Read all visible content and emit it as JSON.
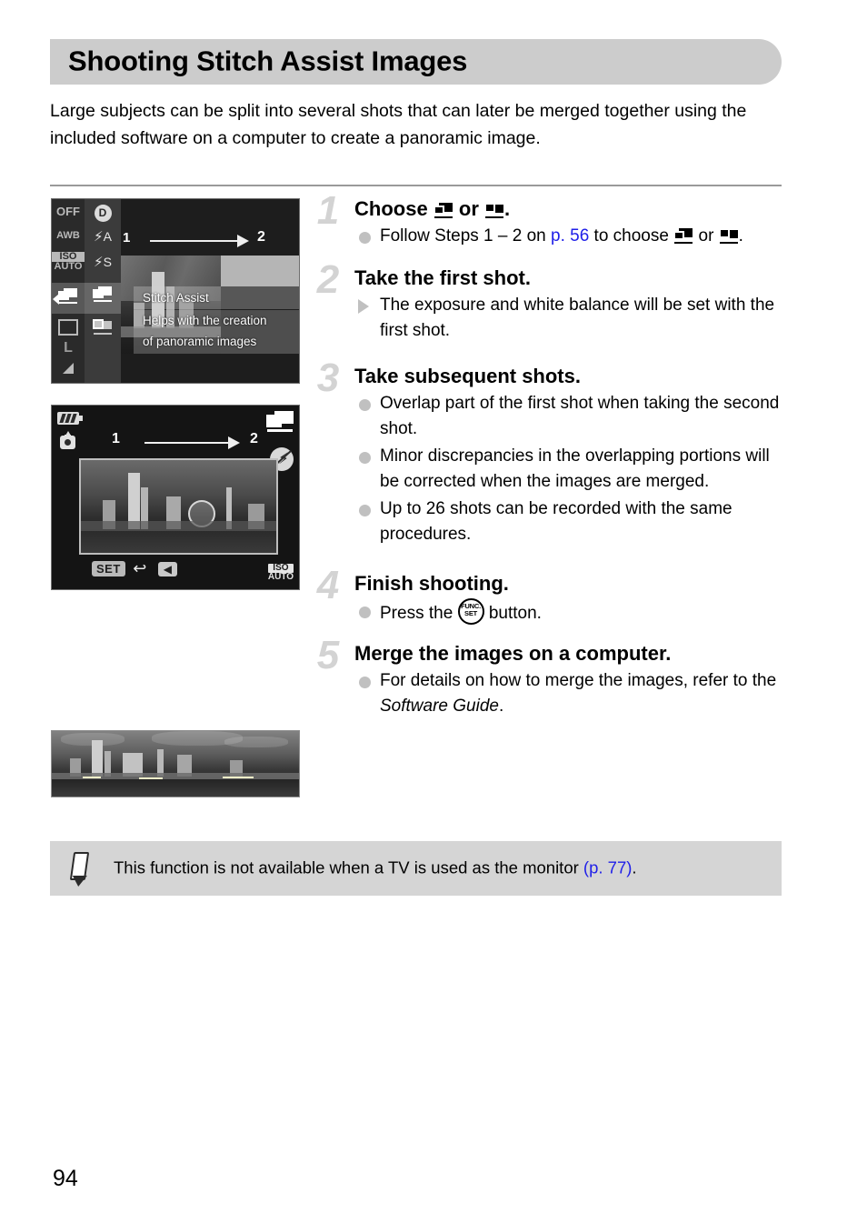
{
  "page": {
    "title": "Shooting Stitch Assist Images",
    "number": "94",
    "intro": "Large subjects can be split into several shots that can later be merged together using the included software on a computer to create a panoramic image."
  },
  "steps": [
    {
      "number": "1",
      "heading_before": "Choose ",
      "heading_mid": " or ",
      "heading_after": ".",
      "bullets": [
        {
          "marker": "dot",
          "text_a": "Follow Steps 1 – 2 on ",
          "link": "p. 56",
          "text_b": " to choose ",
          "text_c": " or ",
          "text_d": "."
        }
      ]
    },
    {
      "number": "2",
      "heading": "Take the first shot.",
      "bullets": [
        {
          "marker": "triangle",
          "text": "The exposure and white balance will be set with the first shot."
        }
      ]
    },
    {
      "number": "3",
      "heading": "Take subsequent shots.",
      "bullets": [
        {
          "marker": "dot",
          "text": "Overlap part of the first shot when taking the second shot."
        },
        {
          "marker": "dot",
          "text": "Minor discrepancies in the overlapping portions will be corrected when the images are merged."
        },
        {
          "marker": "dot",
          "text": "Up to 26 shots can be recorded with the same procedures."
        }
      ]
    },
    {
      "number": "4",
      "heading": "Finish shooting.",
      "bullets": [
        {
          "marker": "dot",
          "text_a": "Press the ",
          "text_b": " button."
        }
      ]
    },
    {
      "number": "5",
      "heading": "Merge the images on a computer.",
      "bullets": [
        {
          "marker": "dot",
          "text_a": "For details on how to merge the images, refer to the ",
          "italic": "Software Guide",
          "text_b": "."
        }
      ]
    }
  ],
  "func_set_button": {
    "line1": "FUNC.",
    "line2": "SET"
  },
  "screen1": {
    "caption_name": "func-menu-stitch-assist",
    "left_column_icons": [
      "OFF",
      "AWB",
      "ISO AUTO",
      "stitch-assist",
      "rectangle",
      "L",
      "corner"
    ],
    "left_column_labels": {
      "flash_off": "OFF",
      "white_balance": "AWB",
      "iso_top": "ISO",
      "iso_bottom": "AUTO",
      "image_size": "L"
    },
    "second_column_icons": [
      "red-eye",
      "flash-auto",
      "flash-slow-sync",
      "stitch-assist-horizontal",
      "stitch-assist-vertical"
    ],
    "second_column_labels": {
      "red_eye": "D",
      "flash_auto": "A",
      "flash_slow": "S"
    },
    "menu_title": "Stitch Assist",
    "menu_desc_line1": "Helps with the creation",
    "menu_desc_line2": "of panoramic images",
    "sequence": {
      "from": "1",
      "to": "2"
    }
  },
  "screen2": {
    "caption_name": "stitch-assist-live-view",
    "sequence": {
      "from": "1",
      "to": "2"
    },
    "icons": [
      "battery",
      "camera-shake-warning",
      "stitch-assist-mode",
      "flash-off"
    ],
    "bottom_controls": {
      "set": "SET",
      "return": "↩",
      "left_arrow": "◀"
    },
    "iso": {
      "line1": "ISO",
      "line2": "AUTO"
    }
  },
  "photo3": {
    "caption_name": "merged-panorama-photo"
  },
  "note": {
    "text_a": "This function is not available when a TV is used as the monitor ",
    "link": "(p. 77)",
    "text_b": "."
  }
}
